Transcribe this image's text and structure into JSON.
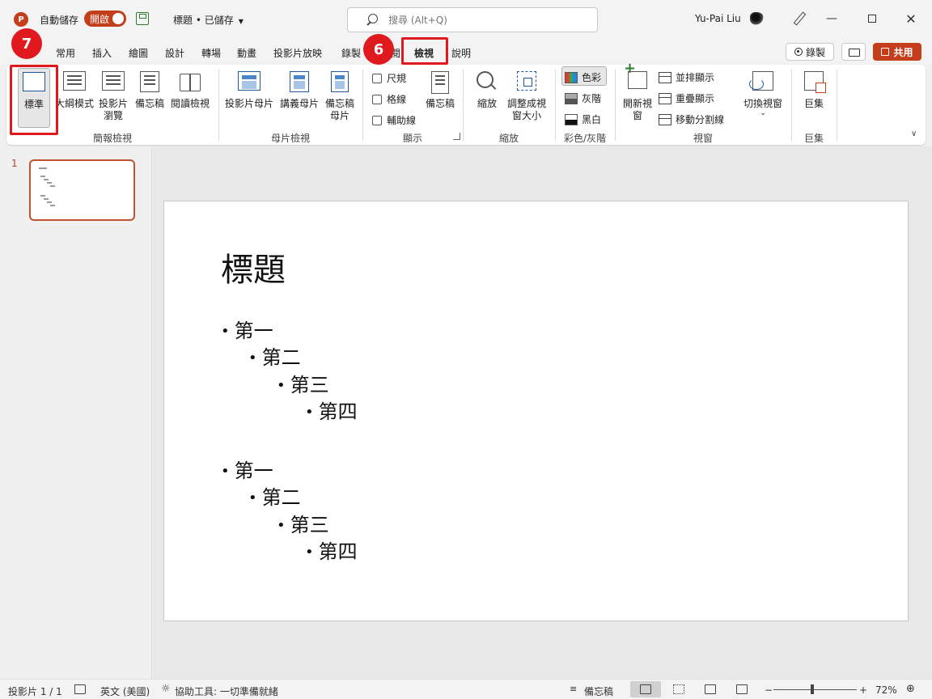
{
  "titlebar": {
    "app_icon": "P",
    "autosave_label": "自動儲存",
    "autosave_state": "開啟",
    "doc_title": "標題 • 已儲存",
    "search_placeholder": "搜尋 (Alt+Q)",
    "user_name": "Yu-Pai Liu",
    "window_controls": [
      "minimize-icon",
      "maximize-icon",
      "close-icon"
    ]
  },
  "tabs": [
    "常用",
    "插入",
    "繪圖",
    "設計",
    "轉場",
    "動畫",
    "投影片放映",
    "錄製",
    "閱",
    "檢視",
    "說明"
  ],
  "active_tab": "檢視",
  "actions": {
    "record": "錄製",
    "share": "共用"
  },
  "ribbon": {
    "presentation_views": {
      "label": "簡報檢視",
      "buttons": [
        "標準",
        "大綱模式",
        "投影片瀏覽",
        "備忘稿",
        "閱讀檢視"
      ]
    },
    "master_views": {
      "label": "母片檢視",
      "buttons": [
        "投影片母片",
        "講義母片",
        "備忘稿母片"
      ]
    },
    "show": {
      "label": "顯示",
      "checkboxes": [
        "尺規",
        "格線",
        "輔助線"
      ],
      "notes_button": "備忘稿"
    },
    "zoom": {
      "label": "縮放",
      "buttons": [
        "縮放",
        "調整成視窗大小"
      ]
    },
    "color": {
      "label": "彩色/灰階",
      "buttons": [
        "色彩",
        "灰階",
        "黑白"
      ],
      "selected": "色彩"
    },
    "window": {
      "label": "視窗",
      "new_window": "開新視窗",
      "small_buttons": [
        "並排顯示",
        "重疊顯示",
        "移動分割線"
      ],
      "switch_windows": "切換視窗"
    },
    "macros": {
      "label": "巨集",
      "button": "巨集"
    }
  },
  "callouts": [
    {
      "number": "7",
      "target": "標準"
    },
    {
      "number": "6",
      "target": "檢視"
    }
  ],
  "thumbnails": [
    {
      "number": "1"
    }
  ],
  "slide": {
    "title": "標題",
    "bullets": [
      {
        "level": 1,
        "text": "第一"
      },
      {
        "level": 2,
        "text": "第二"
      },
      {
        "level": 3,
        "text": "第三"
      },
      {
        "level": 4,
        "text": "第四"
      },
      {
        "level": 1,
        "text": "第一"
      },
      {
        "level": 2,
        "text": "第二"
      },
      {
        "level": 3,
        "text": "第三"
      },
      {
        "level": 4,
        "text": "第四"
      }
    ]
  },
  "statusbar": {
    "slide_count": "投影片 1 / 1",
    "language": "英文 (美國)",
    "accessibility": "協助工具: 一切準備就緒",
    "notes": "備忘稿",
    "zoom_minus": "−",
    "zoom_plus": "+",
    "zoom_level": "72%",
    "zoom_fraction": 0.47
  },
  "colors": {
    "accent": "#c43e1c",
    "callout": "#e0191f"
  }
}
